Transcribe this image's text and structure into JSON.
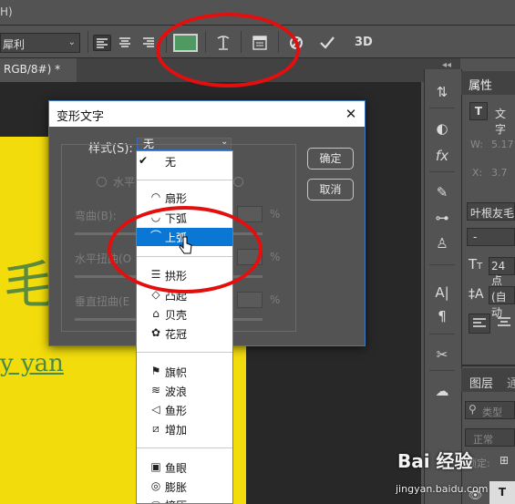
{
  "menubar": {
    "partial_label": "H)"
  },
  "options_bar": {
    "font_name": "犀利",
    "color_swatch": "#4f9a62",
    "icons": [
      "align-left-icon",
      "align-center-icon",
      "align-right-icon",
      "warp-text-icon",
      "character-panel-icon",
      "cancel-icon",
      "commit-icon",
      "3d-icon"
    ],
    "three_d_label": "3D"
  },
  "document": {
    "tab_label": "RGB/8#) *",
    "canvas_color": "#f2dc0c",
    "text_partial_1": "毛 互",
    "text_partial_2": "y yan"
  },
  "panel": {
    "tab": "属性",
    "text_label": "文字",
    "w_label": "W:",
    "w_value": "5.17",
    "x_label": "X:",
    "x_value": "3.7",
    "font_family": "叶根友毛",
    "font_style": "-",
    "font_size": "24点",
    "leading": "(自动",
    "layers_tab": "图层",
    "layers_tab2": "通",
    "kind_label": "类型",
    "blend_mode": "正常",
    "lock_label": "锁定:"
  },
  "dialog": {
    "title": "变形文字",
    "style_label": "样式(S):",
    "style_value": "无",
    "ok": "确定",
    "cancel": "取消",
    "horizontal_label": "水平",
    "bend_label": "弯曲(B):",
    "hdist_label": "水平扭曲(O",
    "vdist_label": "垂直扭曲(E",
    "percent": "%"
  },
  "dropdown": {
    "checked_item": "无",
    "groups": [
      [
        {
          "label": "扇形",
          "icon": "arc-icon"
        },
        {
          "label": "下弧",
          "icon": "arc-lower-icon"
        },
        {
          "label": "上弧",
          "icon": "arc-upper-icon",
          "selected": true
        }
      ],
      [
        {
          "label": "拱形",
          "icon": "arch-icon"
        },
        {
          "label": "凸起",
          "icon": "bulge-icon"
        },
        {
          "label": "贝壳",
          "icon": "shell-icon"
        },
        {
          "label": "花冠",
          "icon": "flower-icon"
        }
      ],
      [
        {
          "label": "旗帜",
          "icon": "flag-icon"
        },
        {
          "label": "波浪",
          "icon": "wave-icon"
        },
        {
          "label": "鱼形",
          "icon": "fish-icon"
        },
        {
          "label": "增加",
          "icon": "rise-icon"
        }
      ],
      [
        {
          "label": "鱼眼",
          "icon": "fisheye-icon"
        },
        {
          "label": "膨胀",
          "icon": "inflate-icon"
        },
        {
          "label": "挤压",
          "icon": "squeeze-icon"
        }
      ]
    ]
  },
  "watermark": {
    "brand": "Bai 经验",
    "url": "jingyan.baidu.com"
  }
}
